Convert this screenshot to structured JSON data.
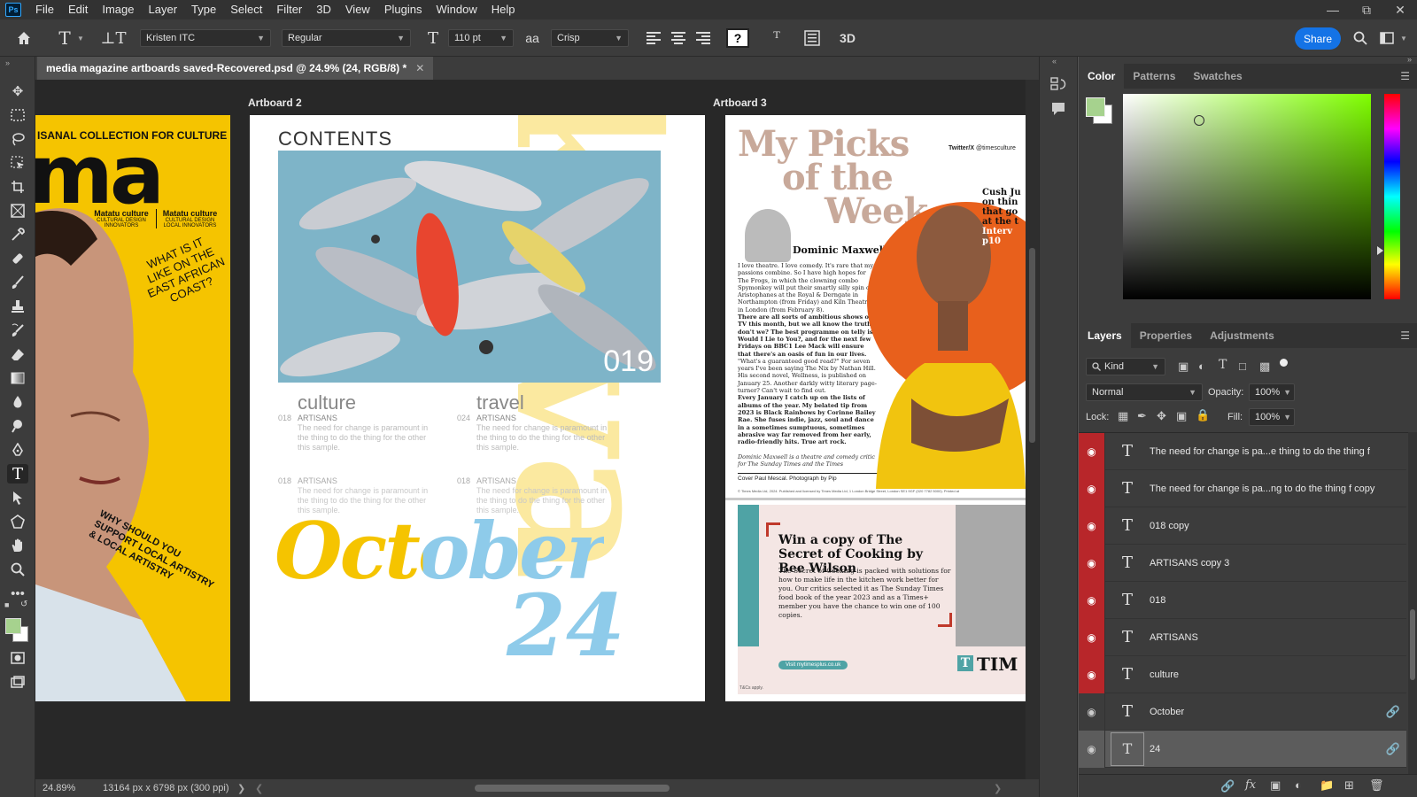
{
  "app": {
    "logo": "Ps",
    "menu": [
      "File",
      "Edit",
      "Image",
      "Layer",
      "Type",
      "Select",
      "Filter",
      "3D",
      "View",
      "Plugins",
      "Window",
      "Help"
    ]
  },
  "options": {
    "font_family": "Kristen ITC",
    "font_style": "Regular",
    "font_size": "110 pt",
    "antialias_icon": "aa",
    "antialias": "Crisp",
    "share": "Share"
  },
  "document": {
    "tab_title": "media magazine artboards saved-Recovered.psd @ 24.9% (24, RGB/8) *",
    "zoom": "24.89%",
    "dimensions": "13164 px x 6798 px (300 ppi)"
  },
  "artboards": {
    "label_2": "Artboard 2",
    "label_3": "Artboard 3"
  },
  "ab1": {
    "top_line_1": "ISANAL COLLECTION FOR ",
    "top_line_2": "CULTURE",
    "masthead": "ma",
    "col1_title": "Matatu culture",
    "col1_sub1": "CULTURAL DESIGN",
    "col1_sub2": "INNOVATORS",
    "col2_title": "Matatu culture",
    "col2_sub1": "CULTURAL DESIGN",
    "col2_sub2": "LOCAL INNOVATORS",
    "headline_1": "WHAT IS IT",
    "headline_2": "LIKE ON THE",
    "headline_3": "EAST AFRICAN",
    "headline_4": "COAST?",
    "footer_1": "WHY SHOULD YOU",
    "footer_2": "SUPPORT LOCAL ARTISTRY",
    "footer_3": "& LOCAL ARTISTRY"
  },
  "ab2": {
    "contents": "CONTENTS",
    "page_number": "019",
    "sec1_title": "culture",
    "sec1_num": "018",
    "sec1_tag": "ARTISANS",
    "sec1_body": "The need for change is paramount in the thing to do the thing for the other this sample.",
    "sec2_title": "travel",
    "sec2_num": "024",
    "sec2_tag": "ARTISANS",
    "sec2_body": "The need for change is paramount in the thing to do the thing for the other this sample.",
    "sec3_num": "018",
    "sec3_tag": "ARTISANS",
    "sec3_body": "The need for change is paramount in the thing to do the thing for the other this sample.",
    "sec4_num": "018",
    "sec4_tag": "ARTISANS",
    "sec4_body": "The need for change is paramount in the thing to do the thing for the other this sample.",
    "script_word": "October",
    "script_num": "24",
    "vertical_word": "kava"
  },
  "ab3": {
    "title_1": "My Picks",
    "title_2": "of the",
    "title_3": "Week",
    "handle_label": "Twitter/X",
    "handle": "@timesculture",
    "author": "Dominic Maxwell",
    "side_1": "Cush Ju",
    "side_2": "on thin",
    "side_3": "that go",
    "side_4": "at the t",
    "side_5": "Interv",
    "side_6": "p10",
    "body_1": "I love theatre. I love comedy. It's rare that my passions combine. So I have high hopes for The Frogs, in which the clowning combo Spymonkey will put their smartly silly spin on Aristophanes at the Royal & Derngate in Northampton (from Friday) and Kiln Theatre in London (from February 8).",
    "body_2": "There are all sorts of ambitious shows on TV this month, but we all know the truth, don't we? The best programme on telly is Would I Lie to You?, and for the next few Fridays on BBC1 Lee Mack will ensure that there's an oasis of fun in our lives.",
    "body_3": "\"What's a guaranteed good read?\" For seven years I've been saying The Nix by Nathan Hill. His second novel, Wellness, is published on January 25. Another darkly witty literary page-turner? Can't wait to find out.",
    "body_4": "Every January I catch up on the lists of albums of the year. My belated tip from 2023 is Black Rainbows by Corinne Bailey Rae. She fuses indie, jazz, soul and dance in a sometimes sumptuous, sometimes abrasive way far removed from her early, radio-friendly hits. True art rock.",
    "bio": "Dominic Maxwell is a theatre and comedy critic for The Sunday Times and the Times",
    "cover": "Cover Paul Mescal. Photograph by Pip",
    "legal": "© Times Media Ltd, 2024. Published and licensed by Times Media Ltd, 1 London Bridge Street, London SE1 9GF (020 7782 5000). Printed at",
    "promo_title": "Win a copy of The Secret of Cooking by Bee Wilson",
    "promo_body": "The Secret of Cooking is packed with solutions for how to make life in the kitchen work better for you. Our critics selected it as The Sunday Times food book of the year 2023 and as a Times+ member you have the chance to win one of 100 copies.",
    "promo_cta": "Visit mytimesplus.co.uk",
    "promo_brand": "TIM",
    "promo_fine": "T&Cs apply."
  },
  "panels": {
    "top_tabs": [
      "Color",
      "Patterns",
      "Swatches"
    ],
    "layer_tabs": [
      "Layers",
      "Properties",
      "Adjustments"
    ],
    "kind": "Kind",
    "blend": "Normal",
    "opacity_label": "Opacity:",
    "opacity": "100%",
    "lock_label": "Lock:",
    "fill_label": "Fill:",
    "fill": "100%"
  },
  "layers": [
    {
      "name": "The need for change is pa...e thing to do the thing f",
      "red": true,
      "linked": false
    },
    {
      "name": "The need for change is pa...ng to do the thing f copy",
      "red": true,
      "linked": false
    },
    {
      "name": "018 copy",
      "red": true,
      "linked": false
    },
    {
      "name": "ARTISANS copy 3",
      "red": true,
      "linked": false
    },
    {
      "name": "018",
      "red": true,
      "linked": false
    },
    {
      "name": "ARTISANS",
      "red": true,
      "linked": false
    },
    {
      "name": "culture",
      "red": true,
      "linked": false
    },
    {
      "name": "October",
      "red": false,
      "linked": true
    },
    {
      "name": "24",
      "red": false,
      "linked": true,
      "selected": true
    }
  ],
  "colors": {
    "foreground": "#a6d28e",
    "background": "#ffffff",
    "accent_yellow": "#f5c400",
    "accent_blue": "#8ecbea",
    "accent_orange": "#e8601c",
    "share_blue": "#1473e6",
    "layer_eye_red": "#b8262a"
  }
}
